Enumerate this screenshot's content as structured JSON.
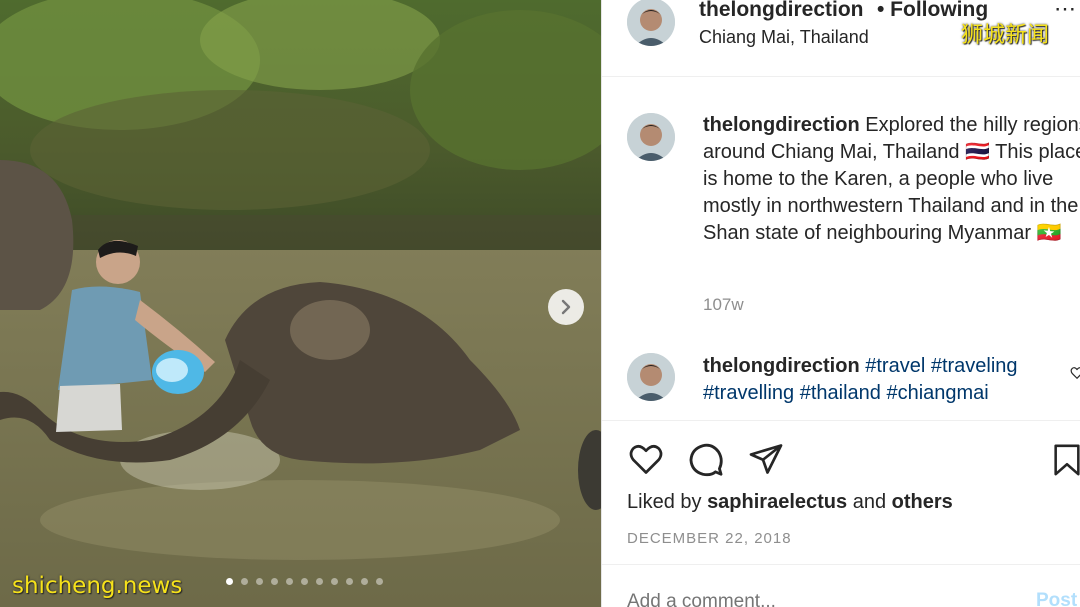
{
  "photo": {
    "alt": "",
    "carousel_total": 11,
    "carousel_active": 0,
    "next_icon": "chevron-right-icon"
  },
  "watermarks": {
    "left": "shicheng.news",
    "right": "狮城新闻"
  },
  "header": {
    "username": "thelongdirection",
    "follow_status": "• Following",
    "location": "Chiang Mai, Thailand",
    "more_icon": "ellipsis-icon"
  },
  "caption": {
    "username": "thelongdirection",
    "text": "Explored the hilly regions around Chiang Mai, Thailand 🇹🇭 This place is home to the Karen, a people who live mostly in northwestern Thailand and in the Shan state of neighbouring Myanmar 🇲🇲",
    "age": "107w"
  },
  "comment": {
    "username": "thelongdirection",
    "tags": "#travel #traveling #travelling #thailand #chiangmai"
  },
  "actions": {
    "like_icon": "heart-icon",
    "comment_icon": "comment-icon",
    "share_icon": "paper-plane-icon",
    "save_icon": "bookmark-icon"
  },
  "likes": {
    "prefix": "Liked by",
    "user": "saphiraelectus",
    "joiner": "and",
    "others": "others"
  },
  "date": "DECEMBER 22, 2018",
  "add_comment": {
    "placeholder": "Add a comment...",
    "post_label": "Post"
  },
  "colors": {
    "text": "#262626",
    "muted": "#8e8e8e",
    "link": "#00376b",
    "post_disabled": "#b2dffc",
    "watermark": "#f6e21a"
  }
}
